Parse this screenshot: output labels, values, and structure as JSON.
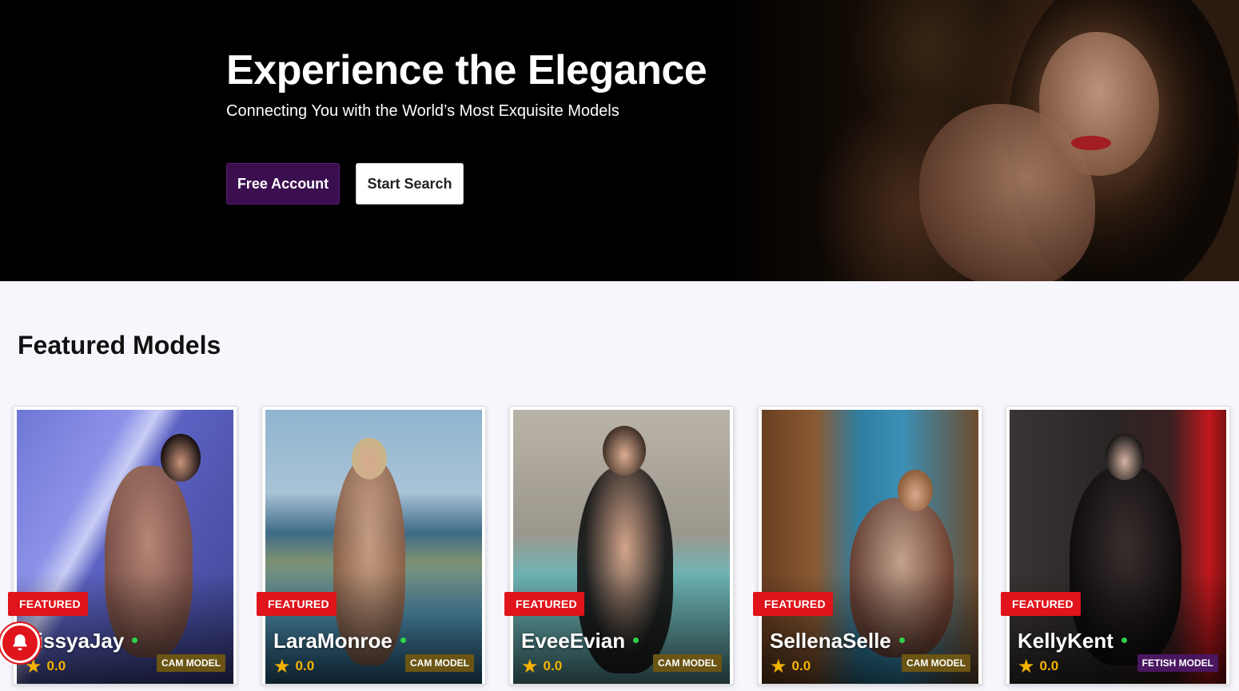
{
  "hero": {
    "title": "Experience the Elegance",
    "subtitle": "Connecting You with the World’s Most Exquisite Models",
    "free_account_label": "Free Account",
    "start_search_label": "Start Search"
  },
  "featured": {
    "title": "Featured Models",
    "cards": [
      {
        "badge": "FEATURED",
        "name": "nissyaJay",
        "rating": "0.0",
        "type": "CAM MODEL",
        "type_color": "#6b5414",
        "online": true
      },
      {
        "badge": "FEATURED",
        "name": "LaraMonroe",
        "rating": "0.0",
        "type": "CAM MODEL",
        "type_color": "#6b5414",
        "online": true
      },
      {
        "badge": "FEATURED",
        "name": "EveeEvian",
        "rating": "0.0",
        "type": "CAM MODEL",
        "type_color": "#6b5414",
        "online": true
      },
      {
        "badge": "FEATURED",
        "name": "SellenaSelle",
        "rating": "0.0",
        "type": "CAM MODEL",
        "type_color": "#6b5414",
        "online": true
      },
      {
        "badge": "FEATURED",
        "name": "KellyKent",
        "rating": "0.0",
        "type": "FETISH MODEL",
        "type_color": "#4a1660",
        "online": true
      }
    ]
  },
  "icons": {
    "star": "star-icon",
    "bell": "bell-icon",
    "online": "online-dot-icon"
  },
  "colors": {
    "accent_purple": "#3b0f4f",
    "featured_red": "#e0141b",
    "star_gold": "#f5b301",
    "online_green": "#2fd34a"
  }
}
